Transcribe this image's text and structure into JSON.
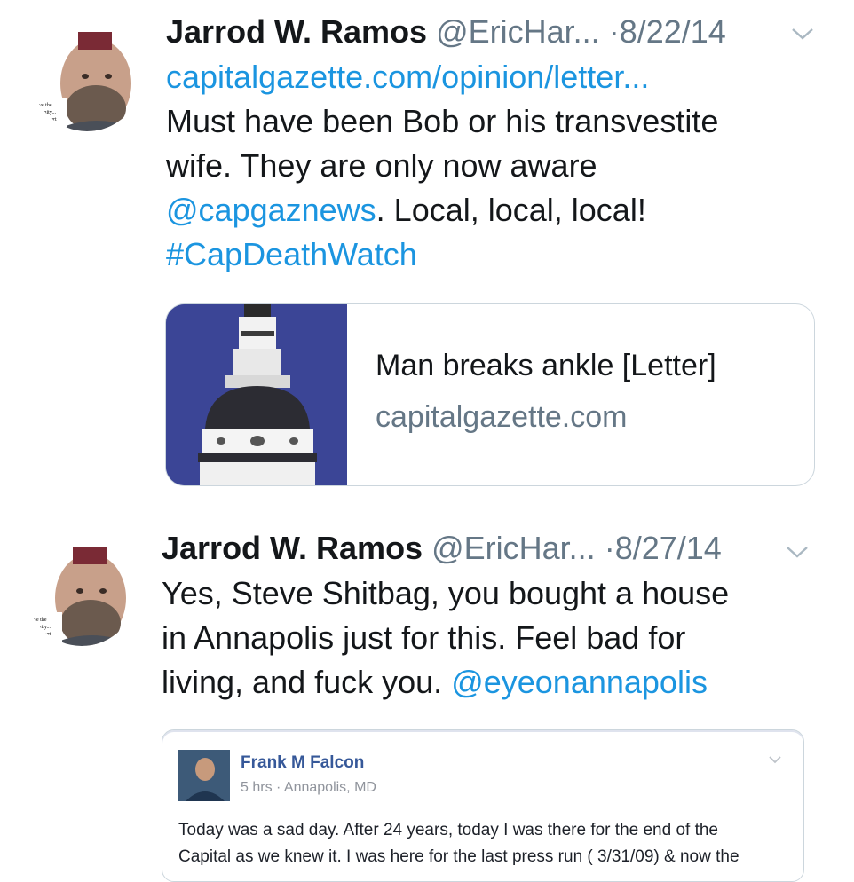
{
  "tweets": [
    {
      "author_name": "Jarrod W. Ramos",
      "handle": "@EricHar...",
      "separator": "·",
      "date": "8/22/14",
      "avatar_sign": [
        "Save the",
        "...unity...",
        "Court"
      ],
      "link_line": "capitalgazette.com/opinion/letter...",
      "text_line_1": "Must have been Bob or his transvestite",
      "text_line_2": "wife. They are only now aware",
      "mention": "@capgaznews",
      "text_after_mention": ". Local, local, local!",
      "hashtag": "#CapDeathWatch",
      "card": {
        "title": "Man breaks ankle [Letter]",
        "domain": "capitalgazette.com"
      }
    },
    {
      "author_name": "Jarrod W. Ramos",
      "handle": "@EricHar...",
      "separator": "·",
      "date": "8/27/14",
      "avatar_sign": [
        "Save the",
        "...unity...",
        "Court"
      ],
      "text_line_1": "Yes, Steve Shitbag, you bought a house",
      "text_line_2": "in Annapolis just for this. Feel bad for",
      "text_line_3_prefix": "living, and fuck you. ",
      "mention": "@eyeonannapolis",
      "embedded_post": {
        "name": "Frank M Falcon",
        "meta": "5 hrs · Annapolis, MD",
        "line_1": "Today was a sad day. After 24 years, today I was there for the end of the",
        "line_2": "Capital as we knew it. I was here for the last press run ( 3/31/09) & now the"
      }
    }
  ],
  "colors": {
    "link": "#1b95e0",
    "muted": "#657786",
    "text": "#14171a",
    "card_border": "#ccd6dd",
    "card_image_bg": "#3b4596",
    "fb_name": "#365899"
  },
  "icons": {
    "caret": "chevron-down-icon",
    "avatar": "profile-photo",
    "card_image": "state-house-dome-image"
  }
}
